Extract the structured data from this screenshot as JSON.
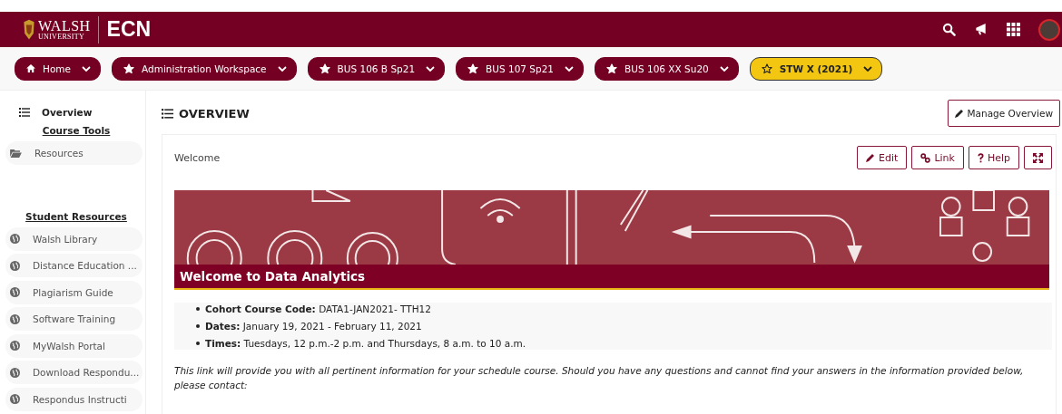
{
  "header": {
    "logo": {
      "name": "WALSH",
      "sub": "UNIVERSITY"
    },
    "title": "ECN"
  },
  "nav_tabs": [
    {
      "kind": "home",
      "label": "Home",
      "selected": false
    },
    {
      "kind": "course",
      "label": "Administration Workspace",
      "selected": false
    },
    {
      "kind": "course",
      "label": "BUS 106 B Sp21",
      "selected": false
    },
    {
      "kind": "course",
      "label": "BUS 107 Sp21",
      "selected": false
    },
    {
      "kind": "course",
      "label": "BUS 106 XX Su20",
      "selected": false
    },
    {
      "kind": "course",
      "label": "STW X (2021)",
      "selected": true
    }
  ],
  "sidebar": {
    "title": "Overview",
    "sections": [
      {
        "heading": "Course Tools",
        "items": [
          {
            "kind": "folder",
            "label": "Resources"
          }
        ]
      },
      {
        "heading": "Student Resources",
        "items": [
          {
            "kind": "link",
            "label": "Walsh Library"
          },
          {
            "kind": "link",
            "label": "Distance Education ..."
          },
          {
            "kind": "link",
            "label": "Plagiarism Guide"
          },
          {
            "kind": "link",
            "label": "Software Training"
          },
          {
            "kind": "link",
            "label": "MyWalsh Portal"
          },
          {
            "kind": "link",
            "label": "Download Respondu..."
          },
          {
            "kind": "link",
            "label": "Respondus Instructi"
          }
        ]
      }
    ]
  },
  "main": {
    "title": "OVERVIEW",
    "manage_button": "Manage Overview",
    "card": {
      "title": "Welcome",
      "buttons": [
        {
          "kind": "edit",
          "label": "Edit"
        },
        {
          "kind": "link",
          "label": "Link"
        },
        {
          "kind": "help",
          "label": "Help"
        },
        {
          "kind": "expand"
        }
      ],
      "banner_title": "Welcome to Data Analytics",
      "bullets": [
        {
          "label": "Cohort Course Code:",
          "value": "DATA1-JAN2021- TTH12"
        },
        {
          "label": "Dates:",
          "value": "January 19, 2021 -  February 11, 2021"
        },
        {
          "label": "Times:",
          "value": "Tuesdays, 12 p.m.-2 p.m. and Thursdays, 8 a.m. to 10 a.m."
        }
      ],
      "paragraph": "This link will provide you with all pertinent information for your schedule course. Should you have any questions and cannot find your answers in the information provided below, please contact:"
    }
  }
}
